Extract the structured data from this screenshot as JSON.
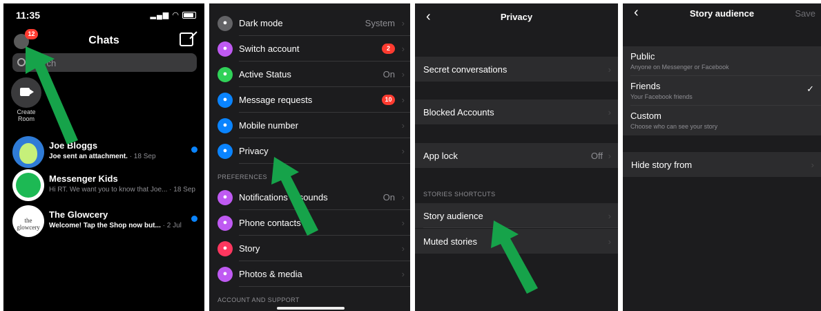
{
  "chats_screen": {
    "time": "11:35",
    "title": "Chats",
    "profile_badge": "12",
    "search_placeholder": "Search",
    "create_room_label": "Create\nRoom",
    "conversations": [
      {
        "name": "Joe Bloggs",
        "preview": "Joe sent an attachment.",
        "date": "· 18 Sep",
        "unread": true
      },
      {
        "name": "Messenger Kids",
        "preview": "Hi RT. We want you to know that Joe...",
        "date": "· 18 Sep",
        "unread": false
      },
      {
        "name": "The Glowcery",
        "preview": "Welcome! Tap the Shop now but...",
        "date": "· 2 Jul",
        "unread": true
      }
    ],
    "glowcery_logo": "the glowcery"
  },
  "settings_screen": {
    "items": [
      {
        "label": "Dark mode",
        "value": "System",
        "icon": "moon-icon",
        "color": "#636366"
      },
      {
        "label": "Switch account",
        "badge": "2",
        "icon": "switch-account-icon",
        "color": "#bf5af2"
      },
      {
        "label": "Active Status",
        "value": "On",
        "icon": "active-status-icon",
        "color": "#30d158"
      },
      {
        "label": "Message requests",
        "badge": "10",
        "icon": "message-requests-icon",
        "color": "#0a84ff"
      },
      {
        "label": "Mobile number",
        "icon": "phone-icon",
        "color": "#0a84ff"
      },
      {
        "label": "Privacy",
        "icon": "shield-icon",
        "color": "#0a84ff"
      }
    ],
    "preferences_header": "PREFERENCES",
    "preference_items": [
      {
        "label": "Notifications & sounds",
        "value": "On",
        "icon": "bell-icon",
        "color": "#bf5af2"
      },
      {
        "label": "Phone contacts",
        "icon": "contacts-icon",
        "color": "#bf5af2"
      },
      {
        "label": "Story",
        "icon": "story-icon",
        "color": "#ff375f"
      },
      {
        "label": "Photos & media",
        "icon": "photos-icon",
        "color": "#bf5af2"
      }
    ],
    "account_header": "ACCOUNT AND SUPPORT"
  },
  "privacy_screen": {
    "title": "Privacy",
    "secret_conversations": "Secret conversations",
    "blocked_accounts": "Blocked Accounts",
    "app_lock": "App lock",
    "app_lock_value": "Off",
    "stories_header": "STORIES SHORTCUTS",
    "story_audience": "Story audience",
    "muted_stories": "Muted stories"
  },
  "story_audience_screen": {
    "title": "Story audience",
    "save": "Save",
    "options": [
      {
        "label": "Public",
        "sub": "Anyone on Messenger or Facebook",
        "checked": false
      },
      {
        "label": "Friends",
        "sub": "Your Facebook friends",
        "checked": true
      },
      {
        "label": "Custom",
        "sub": "Choose who can see your story",
        "checked": false
      }
    ],
    "hide_story_from": "Hide story from"
  },
  "colors": {
    "arrow": "#16a34a",
    "badge": "#ff3b30",
    "unread": "#0a84ff"
  }
}
